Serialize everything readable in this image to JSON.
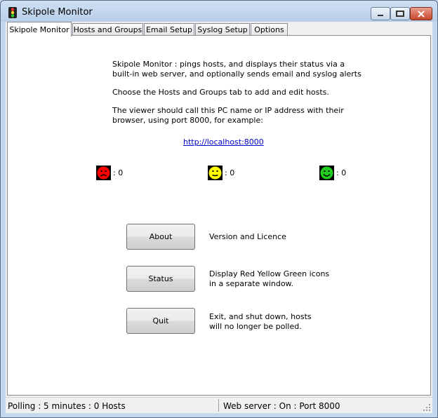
{
  "window": {
    "title": "Skipole Monitor",
    "icon": "traffic-light-icon"
  },
  "tabs": [
    {
      "label": "Skipole Monitor",
      "active": true
    },
    {
      "label": "Hosts and Groups",
      "active": false
    },
    {
      "label": "Email Setup",
      "active": false
    },
    {
      "label": "Syslog Setup",
      "active": false
    },
    {
      "label": "Options",
      "active": false
    }
  ],
  "main": {
    "description_line1": "Skipole Monitor : pings hosts, and displays their status via a",
    "description_line2": "built-in web server, and optionally sends email and syslog alerts",
    "instructions": "Choose the Hosts and Groups tab to add and edit hosts.",
    "viewer_line1": "The viewer should call this PC name or IP address with their",
    "viewer_line2": "browser, using port 8000, for example:",
    "link": "http://localhost:8000",
    "status_counts": {
      "red": ": 0",
      "yellow": ": 0",
      "green": ": 0"
    },
    "colors": {
      "red": "#ff0000",
      "yellow": "#ffff00",
      "green": "#22cc22"
    },
    "buttons": {
      "about": {
        "label": "About",
        "desc1": "Version and Licence",
        "desc2": ""
      },
      "status": {
        "label": "Status",
        "desc1": "Display Red Yellow Green icons",
        "desc2": "in a separate window."
      },
      "quit": {
        "label": "Quit",
        "desc1": "Exit, and shut down, hosts",
        "desc2": "will no longer be polled."
      }
    }
  },
  "statusbar": {
    "polling": "Polling : 5 minutes : 0 Hosts",
    "webserver": "Web server : On : Port 8000"
  }
}
